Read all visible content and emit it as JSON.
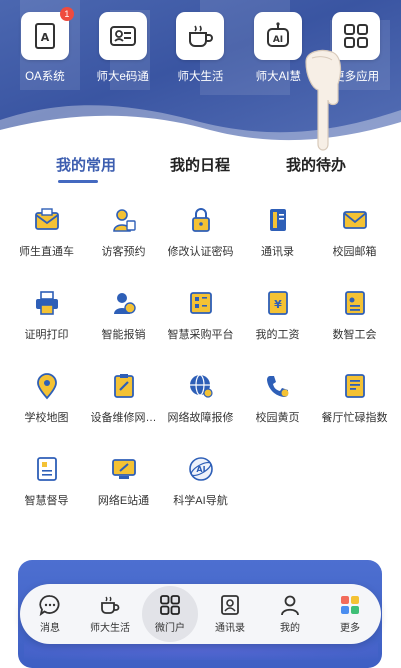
{
  "top_apps": [
    {
      "label": "OA系统",
      "icon": "oa-document-icon",
      "badge": "1"
    },
    {
      "label": "师大e码通",
      "icon": "id-card-icon"
    },
    {
      "label": "师大生活",
      "icon": "coffee-cup-icon"
    },
    {
      "label": "师大AI慧",
      "icon": "ai-robot-icon"
    },
    {
      "label": "更多应用",
      "icon": "grid-apps-icon"
    }
  ],
  "tabs": [
    {
      "label": "我的常用",
      "active": true
    },
    {
      "label": "我的日程",
      "active": false
    },
    {
      "label": "我的待办",
      "active": false
    }
  ],
  "apps": [
    {
      "label": "师生直通车",
      "icon": "mail-envelope-icon"
    },
    {
      "label": "访客预约",
      "icon": "visitor-icon"
    },
    {
      "label": "修改认证密码",
      "icon": "lock-icon"
    },
    {
      "label": "通讯录",
      "icon": "address-book-icon"
    },
    {
      "label": "校园邮箱",
      "icon": "email-icon"
    },
    {
      "label": "证明打印",
      "icon": "printer-icon"
    },
    {
      "label": "智能报销",
      "icon": "reimburse-icon"
    },
    {
      "label": "智慧采购平台",
      "icon": "procurement-icon"
    },
    {
      "label": "我的工资",
      "icon": "salary-icon"
    },
    {
      "label": "数智工会",
      "icon": "union-icon"
    },
    {
      "label": "学校地图",
      "icon": "map-pin-icon"
    },
    {
      "label": "设备维修网…",
      "icon": "repair-icon"
    },
    {
      "label": "网络故障报修",
      "icon": "network-globe-icon"
    },
    {
      "label": "校园黄页",
      "icon": "phone-icon"
    },
    {
      "label": "餐厅忙碌指数",
      "icon": "restaurant-icon"
    },
    {
      "label": "智慧督导",
      "icon": "supervision-icon"
    },
    {
      "label": "网络E站通",
      "icon": "e-station-icon"
    },
    {
      "label": "科学AI导航",
      "icon": "ai-navigation-icon"
    }
  ],
  "nav": [
    {
      "label": "消息",
      "icon": "chat-bubble-icon",
      "active": false
    },
    {
      "label": "师大生活",
      "icon": "coffee-cup-icon",
      "active": false
    },
    {
      "label": "微门户",
      "icon": "grid-icon",
      "active": true
    },
    {
      "label": "通讯录",
      "icon": "contacts-icon",
      "active": false
    },
    {
      "label": "我的",
      "icon": "user-icon",
      "active": false
    },
    {
      "label": "更多",
      "icon": "more-apps-icon",
      "active": false
    }
  ],
  "colors": {
    "header": "#3a55a2",
    "accent": "#3d5eb0",
    "icon_blue": "#2e5fb7",
    "icon_yellow": "#f4c234",
    "badge": "#ef4b3e",
    "card": "#3e5fc4"
  }
}
